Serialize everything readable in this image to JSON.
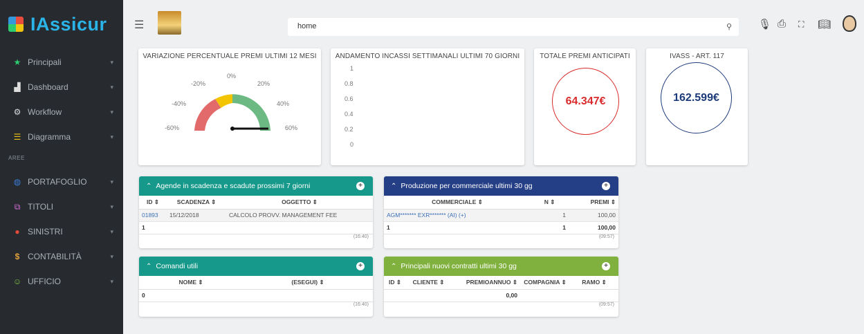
{
  "brand": {
    "name": "IAssicur"
  },
  "sidebar": {
    "items": [
      {
        "label": "Principali",
        "icon": "star-icon"
      },
      {
        "label": "Dashboard",
        "icon": "bar-chart-icon"
      },
      {
        "label": "Workflow",
        "icon": "cog-icon"
      },
      {
        "label": "Diagramma",
        "icon": "list-icon"
      }
    ],
    "section": "AREE",
    "areas": [
      {
        "label": "PORTAFOGLIO",
        "icon": "globe-icon",
        "color": "#3a7bd5"
      },
      {
        "label": "TITOLI",
        "icon": "documents-icon",
        "color": "#d06bd0"
      },
      {
        "label": "SINISTRI",
        "icon": "alert-icon",
        "color": "#e84a3a"
      },
      {
        "label": "CONTABILITÀ",
        "icon": "dollar-icon",
        "color": "#e2a33a"
      },
      {
        "label": "UFFICIO",
        "icon": "smile-icon",
        "color": "#7bc043"
      }
    ]
  },
  "topbar": {
    "search_value": "home"
  },
  "widgets": {
    "gauge_title": "VARIAZIONE PERCENTUALE PREMI ULTIMI 12 MESI",
    "gauge_labels": [
      "-60%",
      "-40%",
      "-20%",
      "0%",
      "20%",
      "40%",
      "60%"
    ],
    "line_title": "ANDAMENTO INCASSI SETTIMANALI ULTIMI 70 GIORNI",
    "line_yticks": [
      "1",
      "0.8",
      "0.6",
      "0.4",
      "0.2",
      "0"
    ],
    "premi_title": "TOTALE PREMI ANTICIPATI",
    "premi_value": "64.347€",
    "ivass_title": "IVASS - ART. 117",
    "ivass_value": "162.599€"
  },
  "panel_agende": {
    "title": "Agende in scadenza e scadute prossimi 7 giorni",
    "headers": [
      "ID ⇕",
      "SCADENZA ⇕",
      "OGGETTO ⇕"
    ],
    "row": [
      "01893",
      "15/12/2018",
      "CALCOLO PROVV. MANAGEMENT FEE"
    ],
    "total": "1",
    "time": "(16:40)"
  },
  "panel_produzione": {
    "title": "Produzione per commerciale ultimi 30 gg",
    "headers": [
      "COMMERCIALE ⇕",
      "N ⇕",
      "PREMI ⇕"
    ],
    "row": [
      "AGM******* EXR******* (AI) (+)",
      "1",
      "100,00"
    ],
    "total": [
      "1",
      "1",
      "100,00"
    ],
    "time": "(09:57)"
  },
  "panel_comandi": {
    "title": "Comandi utili",
    "headers": [
      "NOME ⇕",
      "(ESEGUI) ⇕"
    ],
    "total": "0",
    "time": "(16:40)"
  },
  "panel_contratti": {
    "title": "Principali nuovi contratti ultimi 30 gg",
    "headers": [
      "ID ⇕",
      "CLIENTE ⇕",
      "PREMIOANNUO ⇕",
      "COMPAGNIA ⇕",
      "RAMO ⇕"
    ],
    "total": "0,00",
    "time": "(09:57)"
  },
  "colors": {
    "teal": "#16998a",
    "navy": "#253f86",
    "lime": "#80b13e",
    "red": "#d92b2b",
    "blue": "#1c3a7a"
  }
}
